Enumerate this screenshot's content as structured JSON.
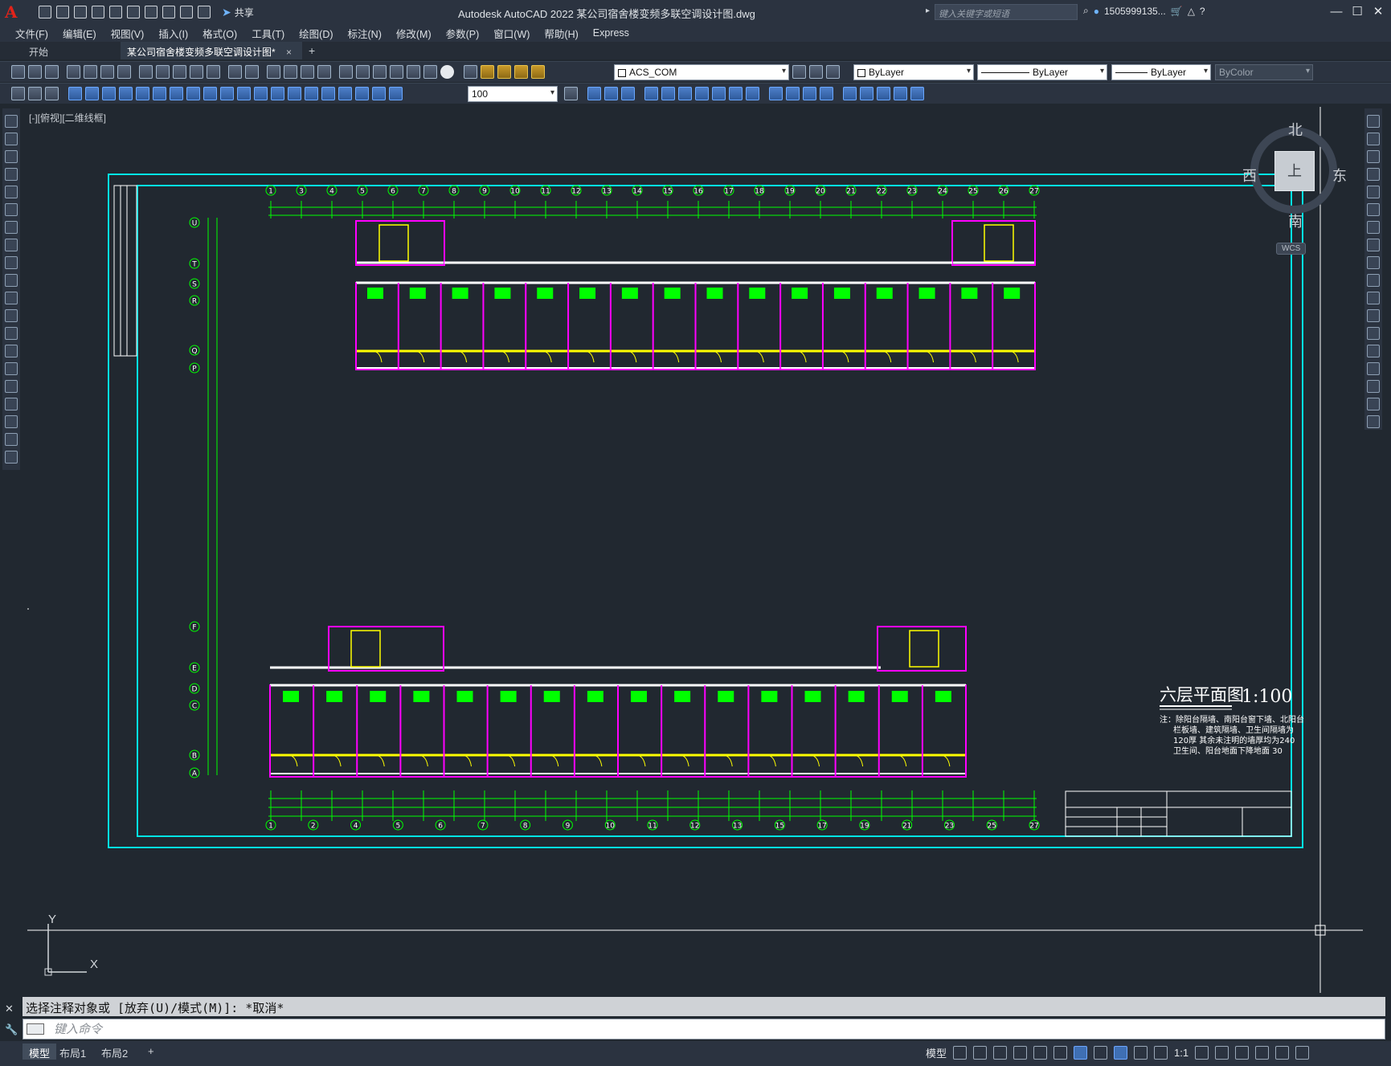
{
  "app": {
    "title": "Autodesk AutoCAD 2022    某公司宿舍楼变频多联空调设计图.dwg",
    "logo": "A",
    "share_label": "共享",
    "search_placeholder": "键入关键字或短语",
    "user": "1505999135...",
    "accent": "#e2231a"
  },
  "menu": [
    "文件(F)",
    "编辑(E)",
    "视图(V)",
    "插入(I)",
    "格式(O)",
    "工具(T)",
    "绘图(D)",
    "标注(N)",
    "修改(M)",
    "参数(P)",
    "窗口(W)",
    "帮助(H)",
    "Express"
  ],
  "doc_tabs": {
    "start": "开始",
    "active": "某公司宿舍楼变频多联空调设计图*",
    "close": "×",
    "add": "+"
  },
  "properties": {
    "layer": "ACS_COM",
    "color": "ByLayer",
    "linetype": "ByLayer",
    "lineweight": "ByLayer",
    "plotstyle": "ByColor",
    "scale": "100"
  },
  "viewport_label": "[-][俯视][二维线框]",
  "viewcube": {
    "north": "北",
    "south": "南",
    "east": "东",
    "west": "西",
    "face": "上",
    "wcs": "WCS"
  },
  "drawing": {
    "title": "六层平面图",
    "scale": "1:100",
    "note_lines": [
      "注：除阳台隔墙、南阳台窗下墙、北阳台",
      "栏板墙、建筑隔墙、卫生间隔墙为",
      "120厚 其余未注明的墙厚均为240",
      "卫生间、阳台地面下降地面 30"
    ],
    "top_axis": [
      "1",
      "3",
      "4",
      "5",
      "6",
      "7",
      "8",
      "9",
      "10",
      "11",
      "12",
      "13",
      "14",
      "15",
      "16",
      "17",
      "18",
      "19",
      "20",
      "21",
      "22",
      "23",
      "24",
      "25",
      "26",
      "27"
    ],
    "bottom_axis": [
      "1",
      "2",
      "4",
      "5",
      "6",
      "7",
      "8",
      "9",
      "10",
      "11",
      "12",
      "13",
      "15",
      "17",
      "19",
      "21",
      "23",
      "25",
      "27"
    ],
    "left_axis_top": [
      "U",
      "T",
      "S",
      "R",
      "Q",
      "P"
    ],
    "left_axis_bottom": [
      "F",
      "E",
      "D",
      "C",
      "B",
      "A"
    ],
    "colors": {
      "frame": "#00e5e5",
      "dim": "#00ff00",
      "wall": "#ff00ff",
      "window": "#ffff00",
      "text": "#ffffff",
      "stair": "#ffff00"
    }
  },
  "ucs": {
    "x": "X",
    "y": "Y"
  },
  "command": {
    "history": "选择注释对象或 [放弃(U)/模式(M)]: *取消*",
    "placeholder": "键入命令"
  },
  "status": {
    "layouts": [
      "模型",
      "布局1",
      "布局2"
    ],
    "model_label": "模型",
    "scale": "1:1",
    "add": "+"
  }
}
